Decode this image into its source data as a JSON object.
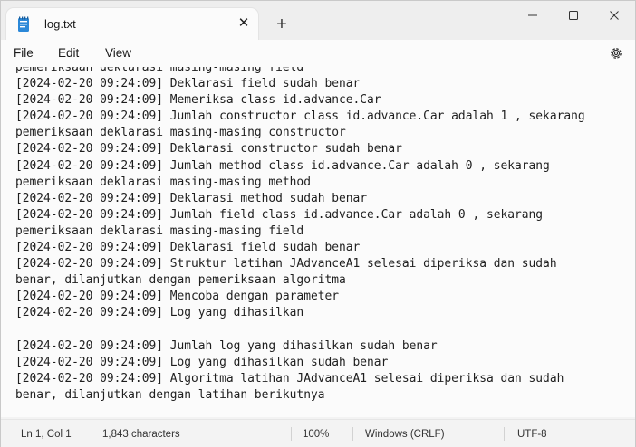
{
  "window": {
    "tab_title": "log.txt",
    "tab_close_glyph": "✕",
    "new_tab_glyph": "+",
    "minimize_icon": "minimize-icon",
    "maximize_icon": "maximize-icon",
    "close_icon": "close-icon"
  },
  "menu": {
    "file": "File",
    "edit": "Edit",
    "view": "View",
    "settings_icon": "gear-icon"
  },
  "editor": {
    "lines": [
      "pemeriksaan deklarasi masing-masing field",
      "[2024-02-20 09:24:09] Deklarasi field sudah benar",
      "[2024-02-20 09:24:09] Memeriksa class id.advance.Car",
      "[2024-02-20 09:24:09] Jumlah constructor class id.advance.Car adalah 1 , sekarang",
      "pemeriksaan deklarasi masing-masing constructor",
      "[2024-02-20 09:24:09] Deklarasi constructor sudah benar",
      "[2024-02-20 09:24:09] Jumlah method class id.advance.Car adalah 0 , sekarang",
      "pemeriksaan deklarasi masing-masing method",
      "[2024-02-20 09:24:09] Deklarasi method sudah benar",
      "[2024-02-20 09:24:09] Jumlah field class id.advance.Car adalah 0 , sekarang",
      "pemeriksaan deklarasi masing-masing field",
      "[2024-02-20 09:24:09] Deklarasi field sudah benar",
      "[2024-02-20 09:24:09] Struktur latihan JAdvanceA1 selesai diperiksa dan sudah",
      "benar, dilanjutkan dengan pemeriksaan algoritma",
      "[2024-02-20 09:24:09] Mencoba dengan parameter",
      "[2024-02-20 09:24:09] Log yang dihasilkan",
      "",
      "[2024-02-20 09:24:09] Jumlah log yang dihasilkan sudah benar",
      "[2024-02-20 09:24:09] Log yang dihasilkan sudah benar",
      "[2024-02-20 09:24:09] Algoritma latihan JAdvanceA1 selesai diperiksa dan sudah",
      "benar, dilanjutkan dengan latihan berikutnya"
    ]
  },
  "status": {
    "position": "Ln 1, Col 1",
    "characters": "1,843 characters",
    "zoom": "100%",
    "line_ending": "Windows (CRLF)",
    "encoding": "UTF-8"
  }
}
